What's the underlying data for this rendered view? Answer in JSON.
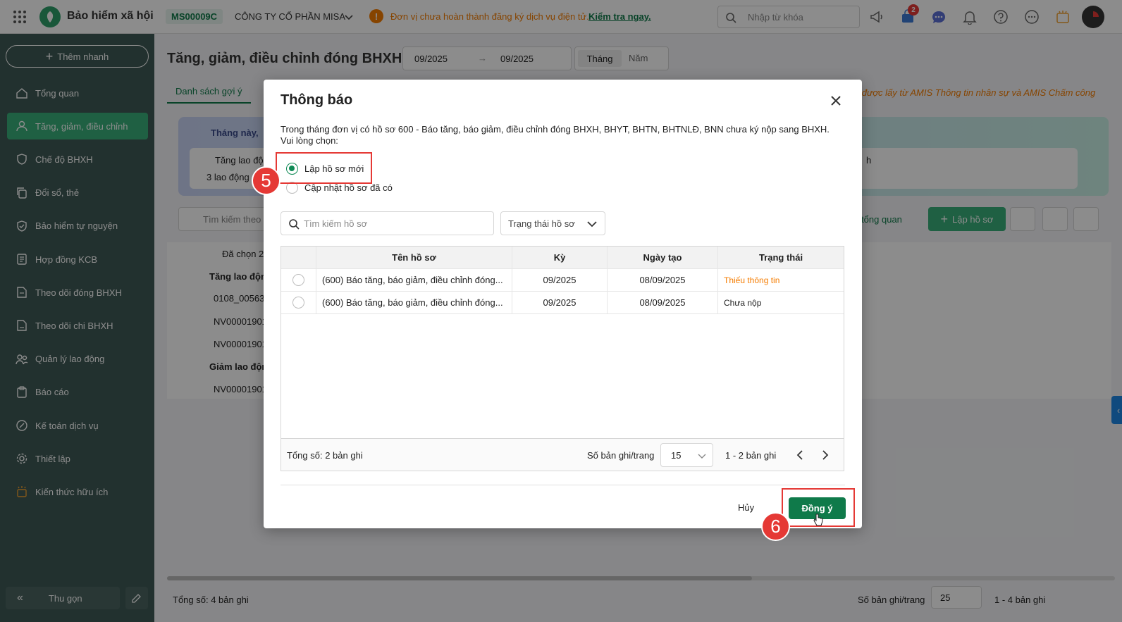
{
  "topbar": {
    "app_title": "Bảo hiểm xã hội",
    "company_code": "MS00009C",
    "company_name": "CÔNG TY CỔ PHẦN MISA",
    "notice_text": "Đơn vị chưa hoàn thành đăng ký dịch vụ điện tử.",
    "notice_link": "Kiểm tra ngay.",
    "search_placeholder": "Nhập từ khóa",
    "cart_badge": "2"
  },
  "sidebar": {
    "quick_add": "Thêm nhanh",
    "items": [
      {
        "label": "Tổng quan",
        "icon": "home-icon"
      },
      {
        "label": "Tăng, giảm, điều chỉnh",
        "icon": "user-icon"
      },
      {
        "label": "Chế độ BHXH",
        "icon": "shield-icon"
      },
      {
        "label": "Đổi sổ, thẻ",
        "icon": "copy-icon"
      },
      {
        "label": "Bảo hiểm tự nguyện",
        "icon": "shield-check-icon"
      },
      {
        "label": "Hợp đồng KCB",
        "icon": "contract-icon"
      },
      {
        "label": "Theo dõi đóng BHXH",
        "icon": "doc-track-icon"
      },
      {
        "label": "Theo dõi chi BHXH",
        "icon": "doc-pay-icon"
      },
      {
        "label": "Quản lý lao động",
        "icon": "users-icon"
      },
      {
        "label": "Báo cáo",
        "icon": "report-icon"
      },
      {
        "label": "Kế toán dịch vụ",
        "icon": "accounting-icon"
      },
      {
        "label": "Thiết lập",
        "icon": "gear-icon"
      },
      {
        "label": "Kiến thức hữu ích",
        "icon": "knowledge-icon"
      }
    ],
    "collapse": "Thu gọn"
  },
  "page": {
    "title": "Tăng, giảm, điều chỉnh đóng BHXH",
    "date_from": "09/2025",
    "date_to": "09/2025",
    "period_month": "Tháng",
    "period_year": "Năm",
    "tab_suggest": "Danh sách gợi ý",
    "info_right": "in được lấy từ AMIS Thông tin nhân sự và AMIS Chấm công",
    "banner_title": "Tháng này,",
    "banner_card_label": "Tăng lao độ",
    "banner_card_count": "3 lao động",
    "banner_right_char": "h",
    "search_placeholder": "Tìm kiếm theo",
    "overview_link": "ẩn tổng quan",
    "create_button": "Lập hồ sơ",
    "selected_count": "Đã chọn 2",
    "group_increase": "Tăng lao động (3",
    "group_decrease": "Giảm lao động (",
    "rows": [
      "0108_00563",
      "NV00001901​2",
      "NV00001901​2",
      "NV00001901​2"
    ],
    "total": "Tổng số: 4 bản ghi",
    "per_page_label": "Số bản ghi/trang",
    "per_page": "25",
    "range": "1 - 4 bản ghi"
  },
  "modal": {
    "title": "Thông báo",
    "message": "Trong tháng đơn vị có hồ sơ 600 - Báo tăng, báo giảm, điều chỉnh đóng BHXH, BHYT, BHTN, BHTNLĐ, BNN chưa ký nộp sang BHXH. Vui lòng chọn:",
    "option_new": "Lập hồ sơ mới",
    "option_update": "Cập nhật hồ sơ đã có",
    "search_placeholder": "Tìm kiếm hồ sơ",
    "status_filter": "Trạng thái hồ sơ",
    "columns": [
      "Tên hồ sơ",
      "Kỳ",
      "Ngày tạo",
      "Trạng thái"
    ],
    "rows": [
      {
        "name": "(600) Báo tăng, báo giảm, điều chỉnh đóng...",
        "period": "09/2025",
        "created": "08/09/2025",
        "status": "Thiếu thông tin"
      },
      {
        "name": "(600) Báo tăng, báo giảm, điều chỉnh đóng...",
        "period": "09/2025",
        "created": "08/09/2025",
        "status": "Chưa nộp"
      }
    ],
    "total": "Tổng số: 2 bản ghi",
    "per_page_label": "Số bản ghi/trang",
    "per_page": "15",
    "range": "1 - 2 bản ghi",
    "cancel": "Hủy",
    "confirm": "Đồng ý"
  },
  "annotations": {
    "step_a": "5",
    "step_b": "6"
  },
  "colors": {
    "sidebar": "#3f5a56",
    "active": "#39b07a",
    "primary": "#0f7a4a",
    "warning": "#f57c00",
    "marker": "#e53935"
  }
}
